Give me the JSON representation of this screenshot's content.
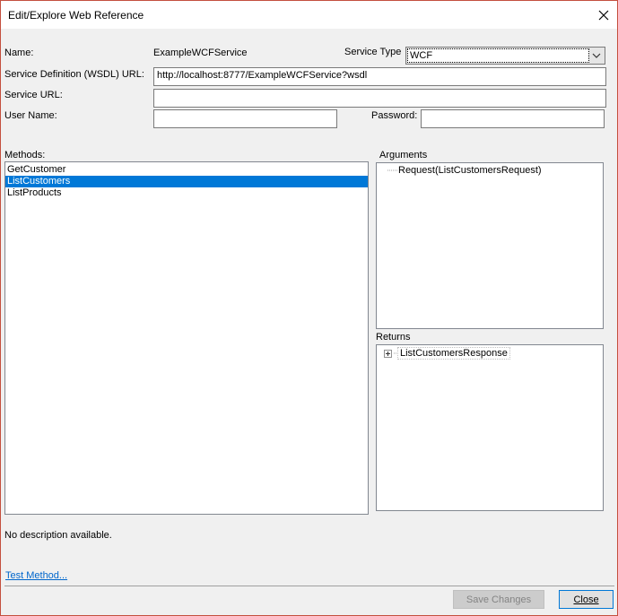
{
  "window": {
    "title": "Edit/Explore Web Reference"
  },
  "form": {
    "name_label": "Name:",
    "name_value": "ExampleWCFService",
    "service_type_label": "Service Type",
    "service_type_value": "WCF",
    "wsdl_label": "Service Definition (WSDL) URL:",
    "wsdl_value": "http://localhost:8777/ExampleWCFService?wsdl",
    "service_url_label": "Service URL:",
    "service_url_value": "",
    "username_label": "User Name:",
    "username_value": "",
    "password_label": "Password:",
    "password_value": ""
  },
  "methods": {
    "label": "Methods:",
    "items": [
      "GetCustomer",
      "ListCustomers",
      "ListProducts"
    ],
    "selected_index": 1
  },
  "arguments": {
    "label": "Arguments",
    "items": [
      "Request(ListCustomersRequest)"
    ]
  },
  "returns": {
    "label": "Returns",
    "items": [
      "ListCustomersResponse"
    ]
  },
  "description": "No description available.",
  "test_method_link": "Test Method...",
  "buttons": {
    "save_label": "Save Changes",
    "close_label": "Close"
  },
  "icons": [
    "close-icon",
    "chevron-down-icon",
    "tree-expand-icon"
  ]
}
